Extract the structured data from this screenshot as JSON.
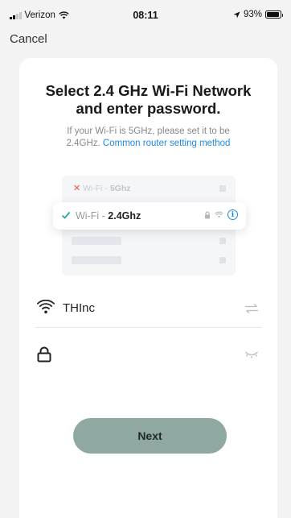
{
  "status_bar": {
    "carrier": "Verizon",
    "time": "08:11",
    "battery": "93%"
  },
  "nav": {
    "cancel_label": "Cancel"
  },
  "main": {
    "title_line1": "Select 2.4 GHz Wi-Fi Network",
    "title_line2": "and enter password.",
    "subtitle_line1": "If your Wi-Fi is 5GHz, please set it to be",
    "subtitle_prefix": "2.4GHz.",
    "subtitle_link": "Common router setting method",
    "illustration": {
      "wrong_prefix": "Wi-Fi -",
      "wrong_band": "5Ghz",
      "right_prefix": "Wi-Fi -",
      "right_band": "2.4Ghz"
    },
    "ssid_value": "THInc",
    "password_value": "",
    "next_label": "Next"
  },
  "colors": {
    "accent": "#1e88e5",
    "error": "#ef5350",
    "success": "#26a69a",
    "button": "#8fa8a1"
  },
  "icons": {
    "wifi": "wifi-icon",
    "lock": "lock-icon",
    "switch": "switch-arrows-icon",
    "hide": "eye-closed-icon"
  }
}
